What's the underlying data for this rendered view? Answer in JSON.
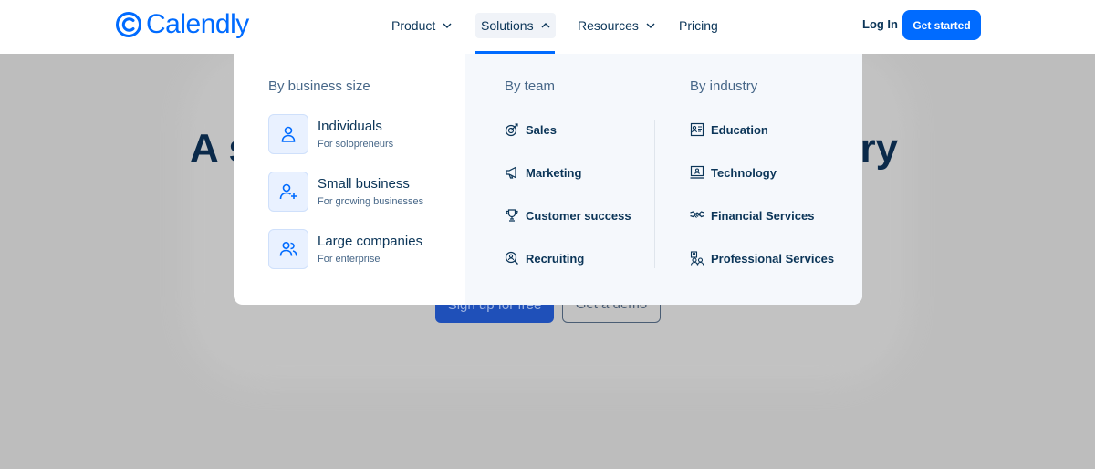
{
  "brand": {
    "name": "Calendly",
    "color": "#006bff"
  },
  "nav": {
    "items": [
      {
        "label": "Product",
        "icon": "chevron-down-icon"
      },
      {
        "label": "Solutions",
        "icon": "chevron-up-icon",
        "active": true
      },
      {
        "label": "Resources",
        "icon": "chevron-down-icon"
      },
      {
        "label": "Pricing"
      }
    ],
    "login_label": "Log In",
    "cta_label": "Get started"
  },
  "hero": {
    "title_left_fragment": "A s",
    "title_right_fragment": "ery",
    "primary_button": "Sign up for free",
    "secondary_button": "Get a demo"
  },
  "solutions_menu": {
    "by_size": {
      "heading": "By business size",
      "items": [
        {
          "title": "Individuals",
          "subtitle": "For solopreneurs",
          "icon": "person-icon"
        },
        {
          "title": "Small business",
          "subtitle": "For growing businesses",
          "icon": "person-add-icon"
        },
        {
          "title": "Large companies",
          "subtitle": "For enterprise",
          "icon": "people-icon"
        }
      ]
    },
    "by_team": {
      "heading": "By team",
      "items": [
        {
          "label": "Sales",
          "icon": "target-icon"
        },
        {
          "label": "Marketing",
          "icon": "megaphone-icon"
        },
        {
          "label": "Customer success",
          "icon": "trophy-icon"
        },
        {
          "label": "Recruiting",
          "icon": "magnifier-person-icon"
        }
      ]
    },
    "by_industry": {
      "heading": "By industry",
      "items": [
        {
          "label": "Education",
          "icon": "education-icon"
        },
        {
          "label": "Technology",
          "icon": "laptop-icon"
        },
        {
          "label": "Financial Services",
          "icon": "handshake-icon"
        },
        {
          "label": "Professional Services",
          "icon": "team-icon"
        }
      ]
    }
  }
}
